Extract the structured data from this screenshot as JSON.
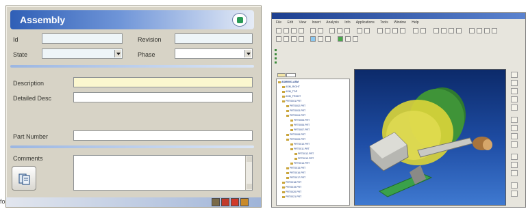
{
  "form": {
    "title": "Assembly",
    "labels": {
      "id": "Id",
      "revision": "Revision",
      "state": "State",
      "phase": "Phase",
      "description": "Description",
      "detailed_desc": "Detailed Desc",
      "part_number": "Part Number",
      "comments": "Comments"
    },
    "values": {
      "id": "",
      "revision": "",
      "state": "",
      "phase": "",
      "description": "",
      "detailed_desc": "",
      "part_number": "",
      "comments": ""
    },
    "icons": {
      "title_badge": "assembly-badge-icon",
      "attach": "attach-document-icon"
    },
    "cut_text": "fo"
  },
  "cad": {
    "menu": [
      "File",
      "Edit",
      "View",
      "Insert",
      "Analysis",
      "Info",
      "Applications",
      "Tools",
      "Window",
      "Help"
    ],
    "tree_root": "ASM0001.ASM",
    "tree_items": [
      "ASM_RIGHT",
      "ASM_TOP",
      "ASM_FRONT",
      "PRT0001.PRT",
      "PRT0002.PRT",
      "PRT0003.PRT",
      "PRT0004.PRT",
      "PRT0005.PRT",
      "PRT0006.PRT",
      "PRT0007.PRT",
      "PRT0008.PRT",
      "PRT0009.PRT",
      "PRT0010.PRT",
      "PRT0011.PRT",
      "PRT0012.PRT",
      "PRT0013.PRT",
      "PRT0014.PRT",
      "PRT0015.PRT",
      "PRT0016.PRT",
      "PRT0017.PRT",
      "PRT0018.PRT",
      "PRT0019.PRT",
      "PRT0020.PRT",
      "PRT0021.PRT"
    ]
  },
  "colors": {
    "title_gradient_start": "#2f5fb6",
    "viewport_background": "#1f4ea6",
    "model_yellow": "#d8d23a",
    "model_green": "#2f7a2f"
  }
}
